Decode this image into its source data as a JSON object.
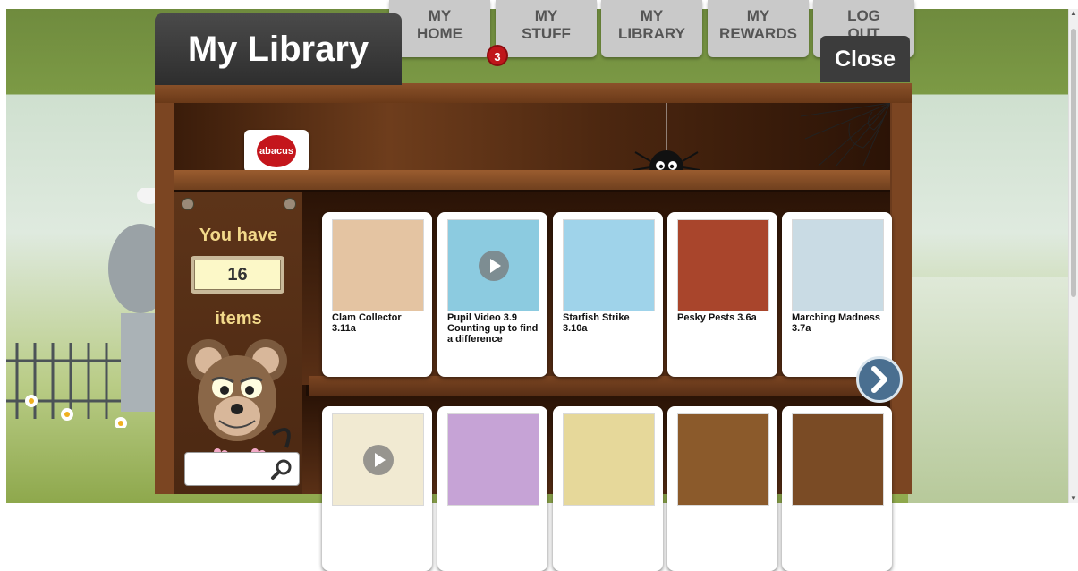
{
  "nav": {
    "tabs": [
      {
        "line1": "MY",
        "line2": "HOME"
      },
      {
        "line1": "MY",
        "line2": "STUFF"
      },
      {
        "line1": "MY",
        "line2": "LIBRARY"
      },
      {
        "line1": "MY",
        "line2": "REWARDS"
      },
      {
        "line1": "LOG",
        "line2": "OUT"
      }
    ],
    "stuff_badge": "3"
  },
  "library": {
    "title": "My Library",
    "close_label": "Close",
    "brand_logo": "abacus"
  },
  "counter": {
    "prefix": "You have",
    "count": "16",
    "suffix": "items"
  },
  "search": {
    "placeholder": "",
    "value": ""
  },
  "shelf1": [
    {
      "title": "Clam Collector 3.11a",
      "thumb_bg": "#e4c4a2",
      "video": false
    },
    {
      "title": "Pupil Video 3.9 Counting up to find a difference",
      "thumb_bg": "#8ccbe0",
      "video": true
    },
    {
      "title": "Starfish Strike 3.10a",
      "thumb_bg": "#9fd3ea",
      "video": false
    },
    {
      "title": "Pesky Pests 3.6a",
      "thumb_bg": "#a9452c",
      "video": false
    },
    {
      "title": "Marching Madness 3.7a",
      "thumb_bg": "#c9dbe4",
      "video": false
    }
  ],
  "shelf2": [
    {
      "title": "",
      "thumb_bg": "#f1ead2",
      "video": true
    },
    {
      "title": "",
      "thumb_bg": "#c6a3d6",
      "video": false
    },
    {
      "title": "",
      "thumb_bg": "#e6d89a",
      "video": false
    },
    {
      "title": "",
      "thumb_bg": "#8b5a2b",
      "video": false
    },
    {
      "title": "",
      "thumb_bg": "#7a4b25",
      "video": false
    }
  ],
  "colors": {
    "accent_red": "#c4161c",
    "wood": "#6b3b1d",
    "arrow_blue": "#4a6f90"
  }
}
